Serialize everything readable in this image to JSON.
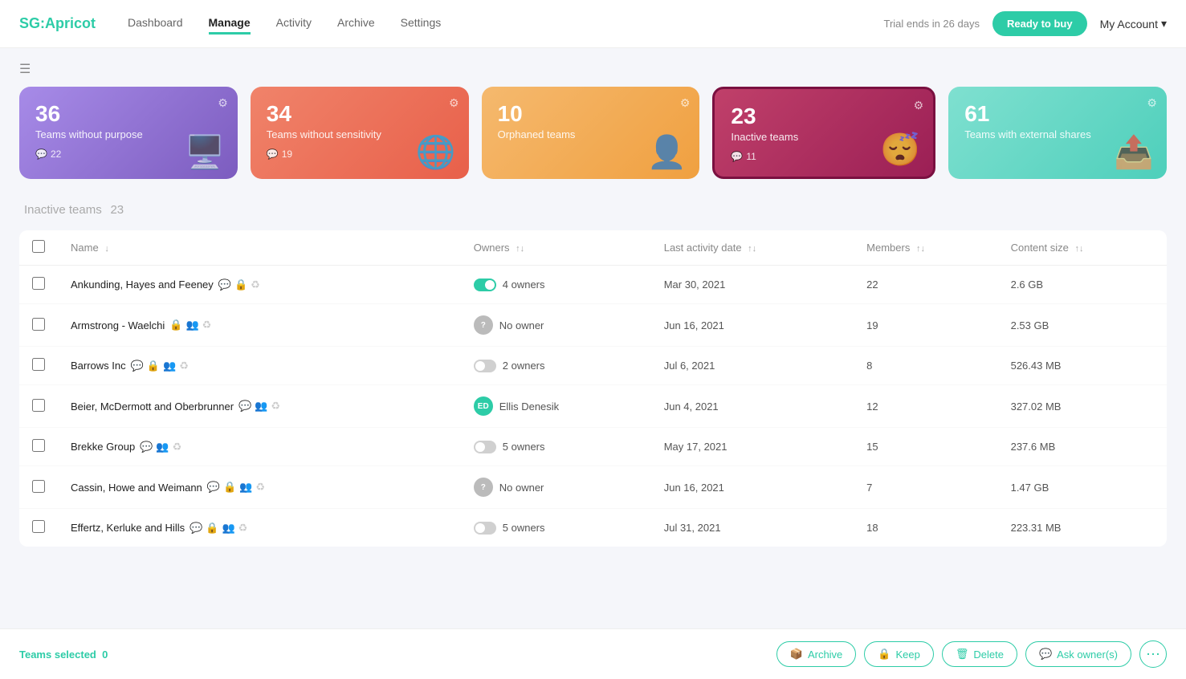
{
  "brand": {
    "logo_sg": "SG:",
    "logo_apricot": "Apricot"
  },
  "nav": {
    "links": [
      {
        "label": "Dashboard",
        "active": false
      },
      {
        "label": "Manage",
        "active": true
      },
      {
        "label": "Activity",
        "active": false
      },
      {
        "label": "Archive",
        "active": false
      },
      {
        "label": "Settings",
        "active": false
      }
    ],
    "trial_text": "Trial ends in 26 days",
    "buy_label": "Ready to buy",
    "account_label": "My Account"
  },
  "stat_cards": [
    {
      "num": "36",
      "label": "Teams without purpose",
      "sub_icon": "💬",
      "sub_count": "22",
      "style": "purple"
    },
    {
      "num": "34",
      "label": "Teams without sensitivity",
      "sub_icon": "💬",
      "sub_count": "19",
      "style": "salmon"
    },
    {
      "num": "10",
      "label": "Orphaned teams",
      "sub_icon": "",
      "sub_count": "",
      "style": "orange"
    },
    {
      "num": "23",
      "label": "Inactive teams",
      "sub_icon": "💬",
      "sub_count": "11",
      "style": "pink"
    },
    {
      "num": "61",
      "label": "Teams with external shares",
      "sub_icon": "",
      "sub_count": "",
      "style": "teal"
    }
  ],
  "section": {
    "title": "Inactive teams",
    "count": "23"
  },
  "table": {
    "columns": [
      {
        "label": "Name",
        "sortable": true
      },
      {
        "label": "Owners",
        "sortable": true
      },
      {
        "label": "Last activity date",
        "sortable": true
      },
      {
        "label": "Members",
        "sortable": true
      },
      {
        "label": "Content size",
        "sortable": true
      }
    ],
    "rows": [
      {
        "name": "Ankunding, Hayes and Feeney",
        "icons": [
          "red-icon",
          "lock-icon",
          "recycle-icon"
        ],
        "owner_type": "toggle_active",
        "owner_label": "4 owners",
        "last_activity": "Mar 30, 2021",
        "members": "22",
        "content_size": "2.6 GB"
      },
      {
        "name": "Armstrong - Waelchi",
        "icons": [
          "lock-icon",
          "group-icon",
          "recycle-icon"
        ],
        "owner_type": "no_owner_gray",
        "owner_label": "No owner",
        "last_activity": "Jun 16, 2021",
        "members": "19",
        "content_size": "2.53 GB"
      },
      {
        "name": "Barrows Inc",
        "icons": [
          "red-icon",
          "lock-icon",
          "group-icon",
          "recycle-icon"
        ],
        "owner_type": "toggle_inactive",
        "owner_label": "2 owners",
        "last_activity": "Jul 6, 2021",
        "members": "8",
        "content_size": "526.43 MB"
      },
      {
        "name": "Beier, McDermott and Oberbrunner",
        "icons": [
          "red-icon",
          "group-icon",
          "recycle-icon"
        ],
        "owner_type": "avatar_green",
        "owner_initials": "ED",
        "owner_label": "Ellis Denesik",
        "last_activity": "Jun 4, 2021",
        "members": "12",
        "content_size": "327.02 MB"
      },
      {
        "name": "Brekke Group",
        "icons": [
          "red-icon",
          "group-icon",
          "recycle-icon"
        ],
        "owner_type": "toggle_inactive",
        "owner_label": "5 owners",
        "last_activity": "May 17, 2021",
        "members": "15",
        "content_size": "237.6 MB"
      },
      {
        "name": "Cassin, Howe and Weimann",
        "icons": [
          "red-icon",
          "lock-icon",
          "group-icon",
          "recycle-icon"
        ],
        "owner_type": "no_owner_gray",
        "owner_label": "No owner",
        "last_activity": "Jun 16, 2021",
        "members": "7",
        "content_size": "1.47 GB"
      },
      {
        "name": "Effertz, Kerluke and Hills",
        "icons": [
          "red-icon",
          "lock-icon",
          "group-icon",
          "recycle-icon"
        ],
        "owner_type": "toggle_inactive",
        "owner_label": "5 owners",
        "last_activity": "Jul 31, 2021",
        "members": "18",
        "content_size": "223.31 MB"
      }
    ]
  },
  "bottom_bar": {
    "selected_label": "Teams selected",
    "selected_count": "0",
    "actions": [
      {
        "label": "Archive",
        "icon": "📦"
      },
      {
        "label": "Keep",
        "icon": "🔒"
      },
      {
        "label": "Delete",
        "icon": "🗑"
      },
      {
        "label": "Ask owner(s)",
        "icon": "💬"
      }
    ],
    "more_label": "⋯"
  }
}
